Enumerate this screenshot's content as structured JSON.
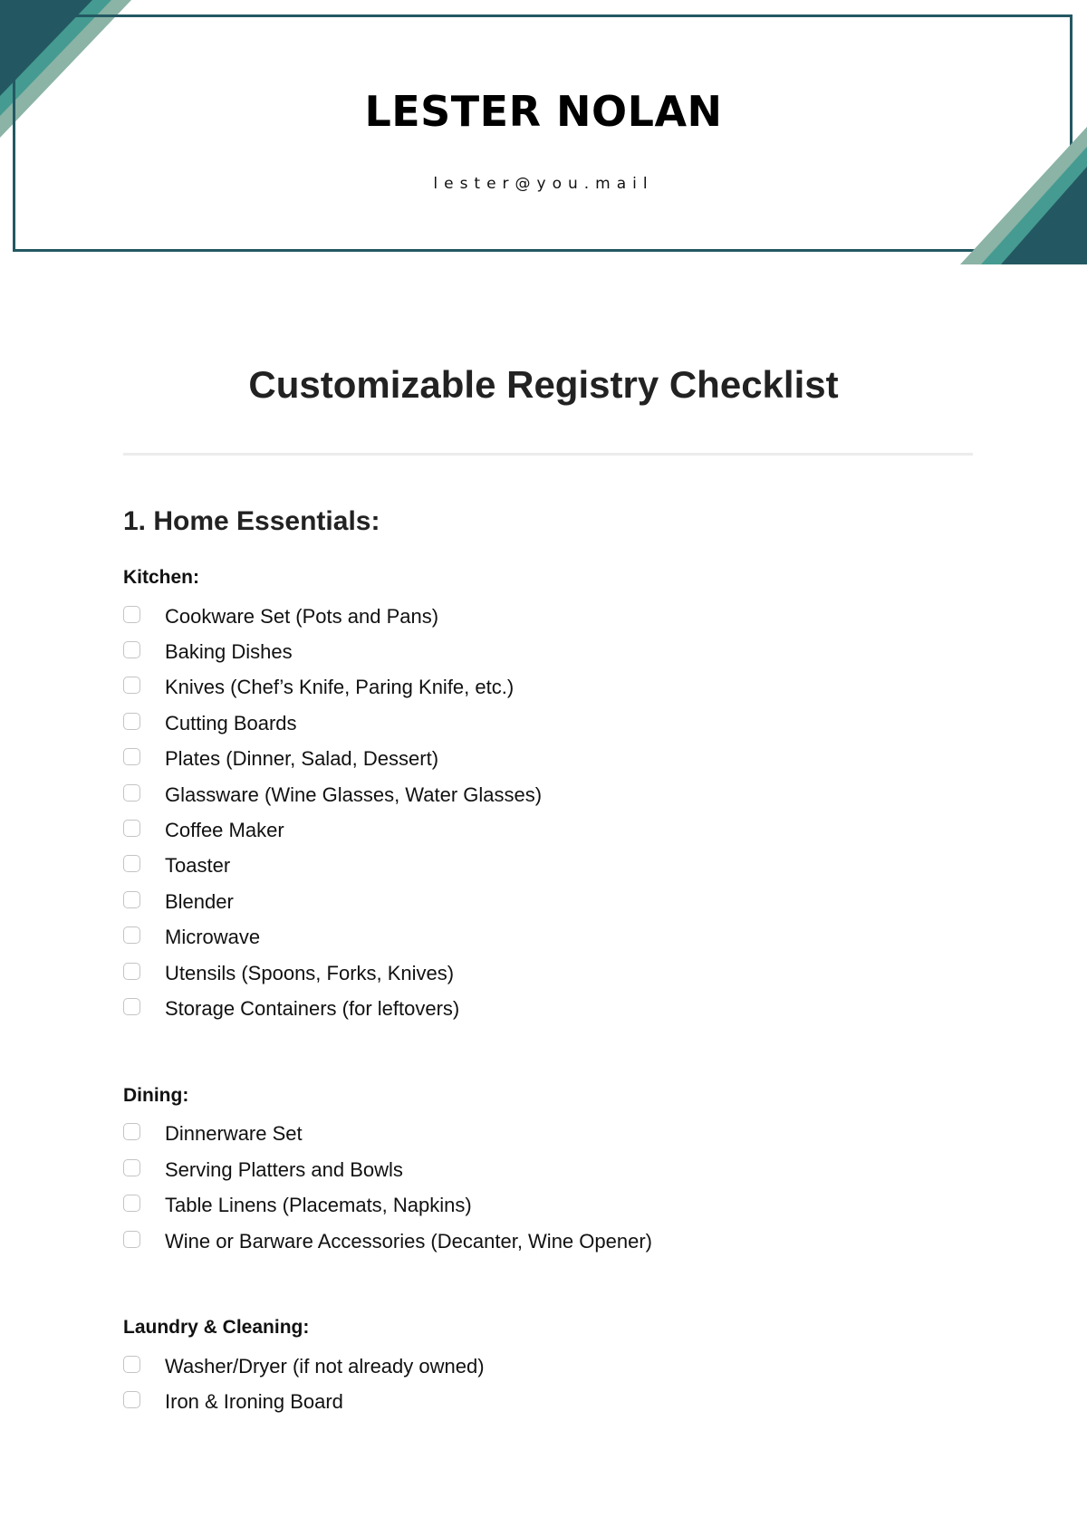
{
  "header": {
    "name": "LESTER NOLAN",
    "email": "lester@you.mail"
  },
  "colors": {
    "dark_teal": "#235862",
    "teal": "#459b91",
    "sage": "#8bb3a6",
    "border": "#235862"
  },
  "document": {
    "title": "Customizable Registry Checklist",
    "sections": [
      {
        "heading": "1. Home Essentials:",
        "groups": [
          {
            "heading": "Kitchen:",
            "items": [
              {
                "label": "Cookware Set (Pots and Pans)",
                "checked": false
              },
              {
                "label": "Baking Dishes",
                "checked": false
              },
              {
                "label": "Knives (Chef’s Knife, Paring Knife, etc.)",
                "checked": false
              },
              {
                "label": "Cutting Boards",
                "checked": false
              },
              {
                "label": "Plates (Dinner, Salad, Dessert)",
                "checked": false
              },
              {
                "label": "Glassware (Wine Glasses, Water Glasses)",
                "checked": false
              },
              {
                "label": "Coffee Maker",
                "checked": false
              },
              {
                "label": "Toaster",
                "checked": false
              },
              {
                "label": "Blender",
                "checked": false
              },
              {
                "label": "Microwave",
                "checked": false
              },
              {
                "label": "Utensils (Spoons, Forks, Knives)",
                "checked": false
              },
              {
                "label": "Storage Containers (for leftovers)",
                "checked": false
              }
            ]
          },
          {
            "heading": "Dining:",
            "items": [
              {
                "label": "Dinnerware Set",
                "checked": false
              },
              {
                "label": "Serving Platters and Bowls",
                "checked": false
              },
              {
                "label": "Table Linens (Placemats, Napkins)",
                "checked": false
              },
              {
                "label": "Wine or Barware Accessories (Decanter, Wine Opener)",
                "checked": false
              }
            ]
          },
          {
            "heading": "Laundry & Cleaning:",
            "items": [
              {
                "label": "Washer/Dryer (if not already owned)",
                "checked": false
              },
              {
                "label": "Iron & Ironing Board",
                "checked": false
              }
            ]
          }
        ]
      }
    ]
  }
}
